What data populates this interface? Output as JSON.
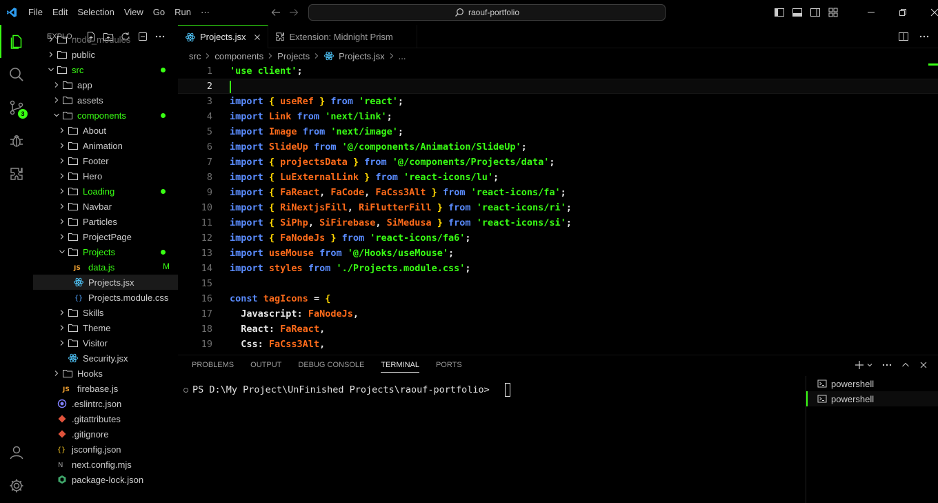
{
  "menu": [
    "File",
    "Edit",
    "Selection",
    "View",
    "Go",
    "Run",
    "···"
  ],
  "search_box": {
    "text": "raouf-portfolio"
  },
  "sidebar": {
    "title": "EXPLO..."
  },
  "source_control_badge": "3",
  "tree": [
    {
      "label": "node_modules",
      "type": "folder",
      "indent": 0,
      "chev": ">",
      "dim": true
    },
    {
      "label": "public",
      "type": "folder",
      "indent": 0,
      "chev": ">"
    },
    {
      "label": "src",
      "type": "folder",
      "indent": 0,
      "chev": "v",
      "green": true,
      "dot": true
    },
    {
      "label": "app",
      "type": "folder",
      "indent": 1,
      "chev": ">"
    },
    {
      "label": "assets",
      "type": "folder",
      "indent": 1,
      "chev": ">"
    },
    {
      "label": "components",
      "type": "folder",
      "indent": 1,
      "chev": "v",
      "green": true,
      "dot": true
    },
    {
      "label": "About",
      "type": "folder",
      "indent": 2,
      "chev": ">"
    },
    {
      "label": "Animation",
      "type": "folder",
      "indent": 2,
      "chev": ">"
    },
    {
      "label": "Footer",
      "type": "folder",
      "indent": 2,
      "chev": ">"
    },
    {
      "label": "Hero",
      "type": "folder",
      "indent": 2,
      "chev": ">"
    },
    {
      "label": "Loading",
      "type": "folder",
      "indent": 2,
      "chev": ">",
      "green": true,
      "dot": true
    },
    {
      "label": "Navbar",
      "type": "folder",
      "indent": 2,
      "chev": ">"
    },
    {
      "label": "Particles",
      "type": "folder",
      "indent": 2,
      "chev": ">"
    },
    {
      "label": "ProjectPage",
      "type": "folder",
      "indent": 2,
      "chev": ">"
    },
    {
      "label": "Projects",
      "type": "folder",
      "indent": 2,
      "chev": "v",
      "green": true,
      "dot": true
    },
    {
      "label": "data.js",
      "type": "js",
      "indent": 3,
      "green": true,
      "badge": "M"
    },
    {
      "label": "Projects.jsx",
      "type": "react",
      "indent": 3,
      "selected": true
    },
    {
      "label": "Projects.module.css",
      "type": "css",
      "indent": 3
    },
    {
      "label": "Skills",
      "type": "folder",
      "indent": 2,
      "chev": ">"
    },
    {
      "label": "Theme",
      "type": "folder",
      "indent": 2,
      "chev": ">"
    },
    {
      "label": "Visitor",
      "type": "folder",
      "indent": 2,
      "chev": ">"
    },
    {
      "label": "Security.jsx",
      "type": "react",
      "indent": 2
    },
    {
      "label": "Hooks",
      "type": "folder",
      "indent": 1,
      "chev": ">"
    },
    {
      "label": "firebase.js",
      "type": "js",
      "indent": 1
    },
    {
      "label": ".eslintrc.json",
      "type": "eslint",
      "indent": 0
    },
    {
      "label": ".gitattributes",
      "type": "git",
      "indent": 0
    },
    {
      "label": ".gitignore",
      "type": "git",
      "indent": 0
    },
    {
      "label": "jsconfig.json",
      "type": "json",
      "indent": 0
    },
    {
      "label": "next.config.mjs",
      "type": "next",
      "indent": 0
    },
    {
      "label": "package-lock.json",
      "type": "npm",
      "indent": 0
    }
  ],
  "tabs": [
    {
      "label": "Projects.jsx",
      "active": true
    },
    {
      "label": "Extension: Midnight Prism",
      "active": false
    }
  ],
  "breadcrumb": [
    "src",
    "components",
    "Projects",
    "Projects.jsx",
    "..."
  ],
  "code": [
    [
      [
        "s",
        "'use client'"
      ],
      [
        "p",
        ";"
      ]
    ],
    [],
    [
      [
        "k",
        "import "
      ],
      [
        "b",
        "{ "
      ],
      [
        "v",
        "useRef "
      ],
      [
        "b",
        "} "
      ],
      [
        "k",
        "from "
      ],
      [
        "s",
        "'react'"
      ],
      [
        "p",
        ";"
      ]
    ],
    [
      [
        "k",
        "import "
      ],
      [
        "v",
        "Link "
      ],
      [
        "k",
        "from "
      ],
      [
        "s",
        "'next/link'"
      ],
      [
        "p",
        ";"
      ]
    ],
    [
      [
        "k",
        "import "
      ],
      [
        "v",
        "Image "
      ],
      [
        "k",
        "from "
      ],
      [
        "s",
        "'next/image'"
      ],
      [
        "p",
        ";"
      ]
    ],
    [
      [
        "k",
        "import "
      ],
      [
        "v",
        "SlideUp "
      ],
      [
        "k",
        "from "
      ],
      [
        "s",
        "'@/components/Animation/SlideUp'"
      ],
      [
        "p",
        ";"
      ]
    ],
    [
      [
        "k",
        "import "
      ],
      [
        "b",
        "{ "
      ],
      [
        "v",
        "projectsData "
      ],
      [
        "b",
        "} "
      ],
      [
        "k",
        "from "
      ],
      [
        "s",
        "'@/components/Projects/data'"
      ],
      [
        "p",
        ";"
      ]
    ],
    [
      [
        "k",
        "import "
      ],
      [
        "b",
        "{ "
      ],
      [
        "v",
        "LuExternalLink "
      ],
      [
        "b",
        "} "
      ],
      [
        "k",
        "from "
      ],
      [
        "s",
        "'react-icons/lu'"
      ],
      [
        "p",
        ";"
      ]
    ],
    [
      [
        "k",
        "import "
      ],
      [
        "b",
        "{ "
      ],
      [
        "v",
        "FaReact"
      ],
      [
        "p",
        ", "
      ],
      [
        "v",
        "FaCode"
      ],
      [
        "p",
        ", "
      ],
      [
        "v",
        "FaCss3Alt "
      ],
      [
        "b",
        "} "
      ],
      [
        "k",
        "from "
      ],
      [
        "s",
        "'react-icons/fa'"
      ],
      [
        "p",
        ";"
      ]
    ],
    [
      [
        "k",
        "import "
      ],
      [
        "b",
        "{ "
      ],
      [
        "v",
        "RiNextjsFill"
      ],
      [
        "p",
        ", "
      ],
      [
        "v",
        "RiFlutterFill "
      ],
      [
        "b",
        "} "
      ],
      [
        "k",
        "from "
      ],
      [
        "s",
        "'react-icons/ri'"
      ],
      [
        "p",
        ";"
      ]
    ],
    [
      [
        "k",
        "import "
      ],
      [
        "b",
        "{ "
      ],
      [
        "v",
        "SiPhp"
      ],
      [
        "p",
        ", "
      ],
      [
        "v",
        "SiFirebase"
      ],
      [
        "p",
        ", "
      ],
      [
        "v",
        "SiMedusa "
      ],
      [
        "b",
        "} "
      ],
      [
        "k",
        "from "
      ],
      [
        "s",
        "'react-icons/si'"
      ],
      [
        "p",
        ";"
      ]
    ],
    [
      [
        "k",
        "import "
      ],
      [
        "b",
        "{ "
      ],
      [
        "v",
        "FaNodeJs "
      ],
      [
        "b",
        "} "
      ],
      [
        "k",
        "from "
      ],
      [
        "s",
        "'react-icons/fa6'"
      ],
      [
        "p",
        ";"
      ]
    ],
    [
      [
        "k",
        "import "
      ],
      [
        "v",
        "useMouse "
      ],
      [
        "k",
        "from "
      ],
      [
        "s",
        "'@/Hooks/useMouse'"
      ],
      [
        "p",
        ";"
      ]
    ],
    [
      [
        "k",
        "import "
      ],
      [
        "v",
        "styles "
      ],
      [
        "k",
        "from "
      ],
      [
        "s",
        "'./Projects.module.css'"
      ],
      [
        "p",
        ";"
      ]
    ],
    [],
    [
      [
        "k",
        "const "
      ],
      [
        "v",
        "tagIcons "
      ],
      [
        "p",
        "= "
      ],
      [
        "b",
        "{"
      ]
    ],
    [
      [
        "prop",
        "  Javascript"
      ],
      [
        "p",
        ": "
      ],
      [
        "v",
        "FaNodeJs"
      ],
      [
        "p",
        ","
      ]
    ],
    [
      [
        "prop",
        "  React"
      ],
      [
        "p",
        ": "
      ],
      [
        "v",
        "FaReact"
      ],
      [
        "p",
        ","
      ]
    ],
    [
      [
        "prop",
        "  Css"
      ],
      [
        "p",
        ": "
      ],
      [
        "v",
        "FaCss3Alt"
      ],
      [
        "p",
        ","
      ]
    ]
  ],
  "current_line": 2,
  "panel_tabs": [
    {
      "label": "PROBLEMS",
      "active": false
    },
    {
      "label": "OUTPUT",
      "active": false
    },
    {
      "label": "DEBUG CONSOLE",
      "active": false
    },
    {
      "label": "TERMINAL",
      "active": true
    },
    {
      "label": "PORTS",
      "active": false
    }
  ],
  "terminal": {
    "prompt": "PS D:\\My Project\\UnFinished Projects\\raouf-portfolio> "
  },
  "terminal_list": [
    {
      "label": "powershell",
      "active": false
    },
    {
      "label": "powershell",
      "active": true
    }
  ],
  "colors": {
    "accent": "#39ff14",
    "keyword": "#5a8cff",
    "variable": "#ff6b1a",
    "bracket": "#ffd700"
  }
}
